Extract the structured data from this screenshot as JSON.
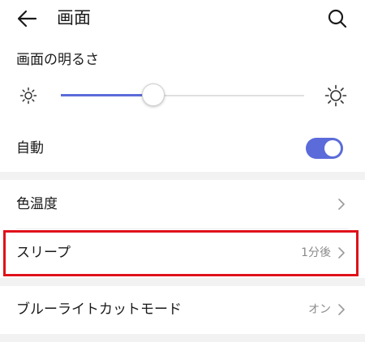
{
  "header": {
    "title": "画面",
    "back_icon": "arrow-left-icon",
    "search_icon": "search-icon"
  },
  "brightness": {
    "label": "画面の明るさ",
    "level_fraction": 0.38,
    "min_icon": "sun-small-icon",
    "max_icon": "sun-large-icon"
  },
  "auto": {
    "label": "自動",
    "enabled": true
  },
  "list": [
    {
      "label": "色温度",
      "value": ""
    },
    {
      "label": "スリープ",
      "value": "1分後"
    },
    {
      "label": "ブルーライトカットモード",
      "value": "オン"
    }
  ],
  "colors": {
    "accent": "#5b6bd9",
    "highlight": "#e0101a",
    "section_gap": "#f2f2f2",
    "secondary_text": "#8a8a8a"
  }
}
